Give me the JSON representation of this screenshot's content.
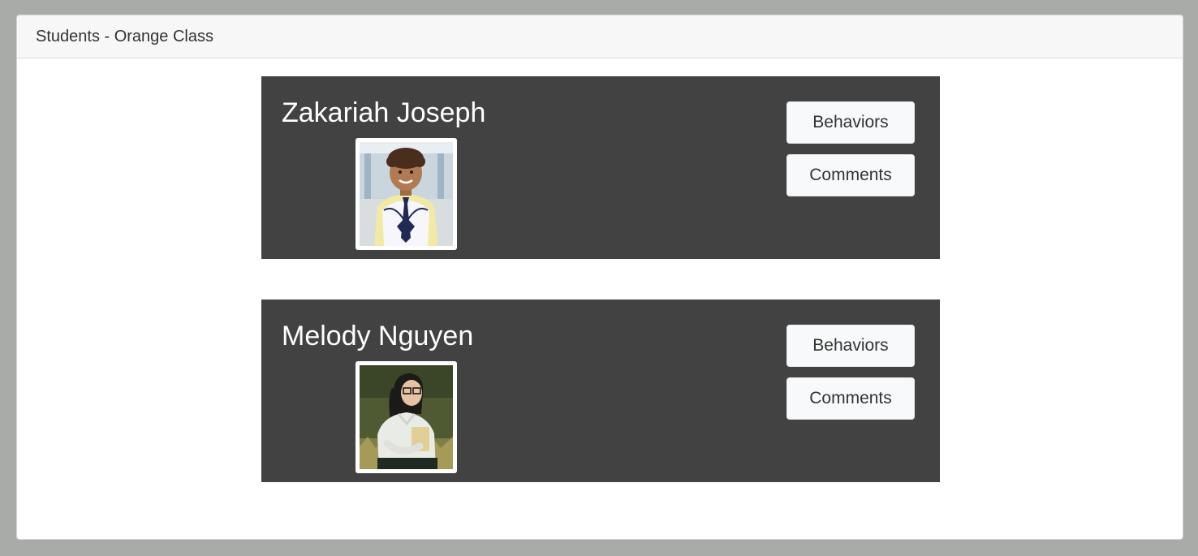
{
  "panel": {
    "title": "Students - Orange Class"
  },
  "students": [
    {
      "name": "Zakariah Joseph",
      "photo_icon": "student-photo",
      "behaviors_label": "Behaviors",
      "comments_label": "Comments"
    },
    {
      "name": "Melody Nguyen",
      "photo_icon": "student-photo",
      "behaviors_label": "Behaviors",
      "comments_label": "Comments"
    }
  ],
  "colors": {
    "page_background": "#a9aba8",
    "card_background": "#424242",
    "button_background": "#f8f9fa",
    "header_background": "#f7f7f7"
  }
}
